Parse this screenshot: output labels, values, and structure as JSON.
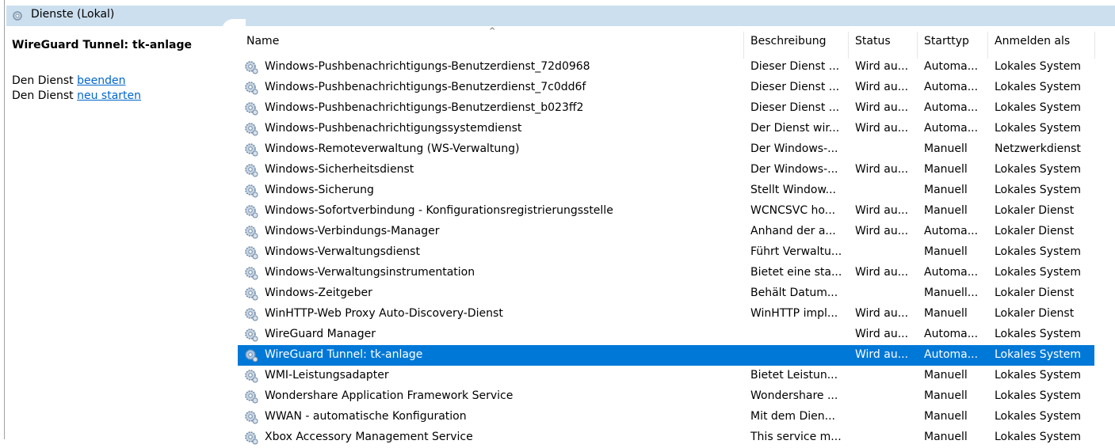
{
  "window": {
    "header_title": "Dienste (Lokal)"
  },
  "details": {
    "title": "WireGuard Tunnel: tk-anlage",
    "stop_prefix": "Den Dienst ",
    "stop_link": "beenden",
    "restart_prefix": "Den Dienst ",
    "restart_link": "neu starten"
  },
  "columns": {
    "name": "Name",
    "description": "Beschreibung",
    "status": "Status",
    "starttype": "Starttyp",
    "logon": "Anmelden als",
    "sort_indicator": "^"
  },
  "services": [
    {
      "name": "Windows-Pushbenachrichtigungs-Benutzerdienst_72d0968",
      "desc": "Dieser Dienst ...",
      "status": "Wird au...",
      "start": "Automa...",
      "logon": "Lokales System"
    },
    {
      "name": "Windows-Pushbenachrichtigungs-Benutzerdienst_7c0dd6f",
      "desc": "Dieser Dienst ...",
      "status": "Wird au...",
      "start": "Automa...",
      "logon": "Lokales System"
    },
    {
      "name": "Windows-Pushbenachrichtigungs-Benutzerdienst_b023ff2",
      "desc": "Dieser Dienst ...",
      "status": "Wird au...",
      "start": "Automa...",
      "logon": "Lokales System"
    },
    {
      "name": "Windows-Pushbenachrichtigungssystemdienst",
      "desc": "Der Dienst wir...",
      "status": "Wird au...",
      "start": "Automa...",
      "logon": "Lokales System"
    },
    {
      "name": "Windows-Remoteverwaltung (WS-Verwaltung)",
      "desc": "Der Windows-...",
      "status": "",
      "start": "Manuell",
      "logon": "Netzwerkdienst"
    },
    {
      "name": "Windows-Sicherheitsdienst",
      "desc": "Der Windows-...",
      "status": "Wird au...",
      "start": "Manuell",
      "logon": "Lokales System"
    },
    {
      "name": "Windows-Sicherung",
      "desc": "Stellt Window...",
      "status": "",
      "start": "Manuell",
      "logon": "Lokales System"
    },
    {
      "name": "Windows-Sofortverbindung - Konfigurationsregistrierungsstelle",
      "desc": "WCNCSVC ho...",
      "status": "Wird au...",
      "start": "Manuell",
      "logon": "Lokaler Dienst"
    },
    {
      "name": "Windows-Verbindungs-Manager",
      "desc": "Anhand der a...",
      "status": "Wird au...",
      "start": "Automa...",
      "logon": "Lokaler Dienst"
    },
    {
      "name": "Windows-Verwaltungsdienst",
      "desc": "Führt Verwaltu...",
      "status": "",
      "start": "Manuell",
      "logon": "Lokales System"
    },
    {
      "name": "Windows-Verwaltungsinstrumentation",
      "desc": "Bietet eine sta...",
      "status": "Wird au...",
      "start": "Automa...",
      "logon": "Lokales System"
    },
    {
      "name": "Windows-Zeitgeber",
      "desc": "Behält Datum...",
      "status": "",
      "start": "Manuell...",
      "logon": "Lokaler Dienst"
    },
    {
      "name": "WinHTTP-Web Proxy Auto-Discovery-Dienst",
      "desc": "WinHTTP impl...",
      "status": "Wird au...",
      "start": "Manuell",
      "logon": "Lokaler Dienst"
    },
    {
      "name": "WireGuard Manager",
      "desc": "",
      "status": "Wird au...",
      "start": "Automa...",
      "logon": "Lokales System"
    },
    {
      "name": "WireGuard Tunnel: tk-anlage",
      "desc": "",
      "status": "Wird au...",
      "start": "Automa...",
      "logon": "Lokales System",
      "selected": true
    },
    {
      "name": "WMI-Leistungsadapter",
      "desc": "Bietet Leistun...",
      "status": "",
      "start": "Manuell",
      "logon": "Lokales System"
    },
    {
      "name": "Wondershare Application Framework Service",
      "desc": "Wondershare ...",
      "status": "",
      "start": "Manuell",
      "logon": "Lokales System"
    },
    {
      "name": "WWAN - automatische Konfiguration",
      "desc": "Mit dem Dien...",
      "status": "",
      "start": "Manuell",
      "logon": "Lokales System"
    },
    {
      "name": "Xbox Accessory Management Service",
      "desc": "This service m...",
      "status": "",
      "start": "Manuell",
      "logon": "Lokales System"
    }
  ],
  "colors": {
    "selection": "#0078d7",
    "header_bg": "#ccdfef",
    "link": "#0066cc"
  },
  "icons": {
    "header": "services-gear-icon",
    "row": "service-gear-icon"
  }
}
